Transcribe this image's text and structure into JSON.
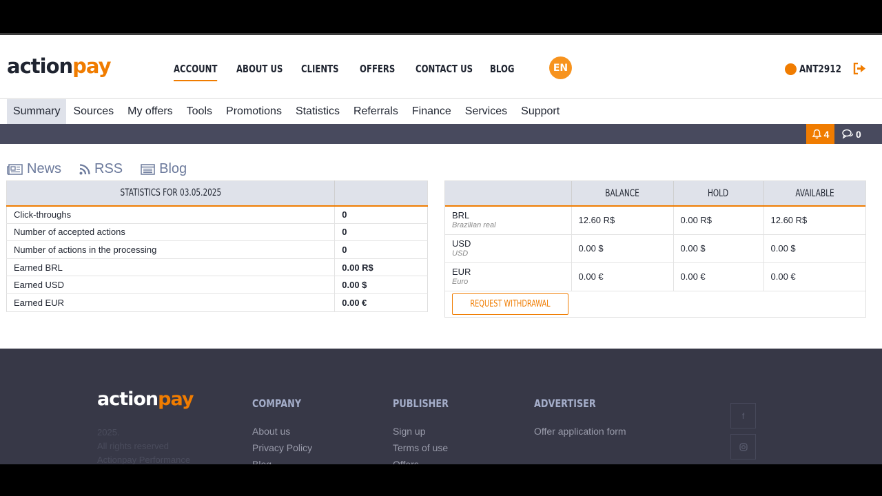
{
  "header": {
    "logo_action": "action",
    "logo_pay": "pay",
    "nav": [
      "ACCOUNT",
      "ABOUT US",
      "CLIENTS",
      "OFFERS",
      "CONTACT US",
      "BLOG"
    ],
    "lang": "EN",
    "username": "ANT2912"
  },
  "subnav": [
    "Summary",
    "Sources",
    "My offers",
    "Tools",
    "Promotions",
    "Statistics",
    "Referrals",
    "Finance",
    "Services",
    "Support"
  ],
  "notifications": {
    "bell_count": "4",
    "message_count": "0"
  },
  "feeds": [
    "News",
    "RSS",
    "Blog"
  ],
  "stats": {
    "header": "STATISTICS FOR 03.05.2025",
    "rows": [
      {
        "label": "Click-throughs",
        "value": "0"
      },
      {
        "label": "Number of accepted actions",
        "value": "0"
      },
      {
        "label": "Number of actions in the processing",
        "value": "0"
      },
      {
        "label": "Earned BRL",
        "value": "0.00 R$"
      },
      {
        "label": "Earned USD",
        "value": "0.00 $"
      },
      {
        "label": "Earned EUR",
        "value": "0.00 €"
      }
    ]
  },
  "balance": {
    "columns": [
      "BALANCE",
      "HOLD",
      "AVAILABLE"
    ],
    "rows": [
      {
        "code": "BRL",
        "name": "Brazilian real",
        "balance": "12.60 R$",
        "hold": "0.00 R$",
        "available": "12.60 R$"
      },
      {
        "code": "USD",
        "name": "USD",
        "balance": "0.00 $",
        "hold": "0.00 $",
        "available": "0.00 $"
      },
      {
        "code": "EUR",
        "name": "Euro",
        "balance": "0.00 €",
        "hold": "0.00 €",
        "available": "0.00 €"
      }
    ],
    "withdraw_label": "REQUEST WITHDRAWAL"
  },
  "footer": {
    "logo_action": "action",
    "logo_pay": "pay",
    "year": "2025.",
    "rights": "All rights reserved",
    "company_name": "Actionpay Performance",
    "company": {
      "title": "COMPANY",
      "links": [
        "About us",
        "Privacy Policy",
        "Blog"
      ]
    },
    "publisher": {
      "title": "PUBLISHER",
      "links": [
        "Sign up",
        "Terms of use",
        "Offers"
      ]
    },
    "advertiser": {
      "title": "ADVERTISER",
      "links": [
        "Offer application form"
      ]
    }
  }
}
